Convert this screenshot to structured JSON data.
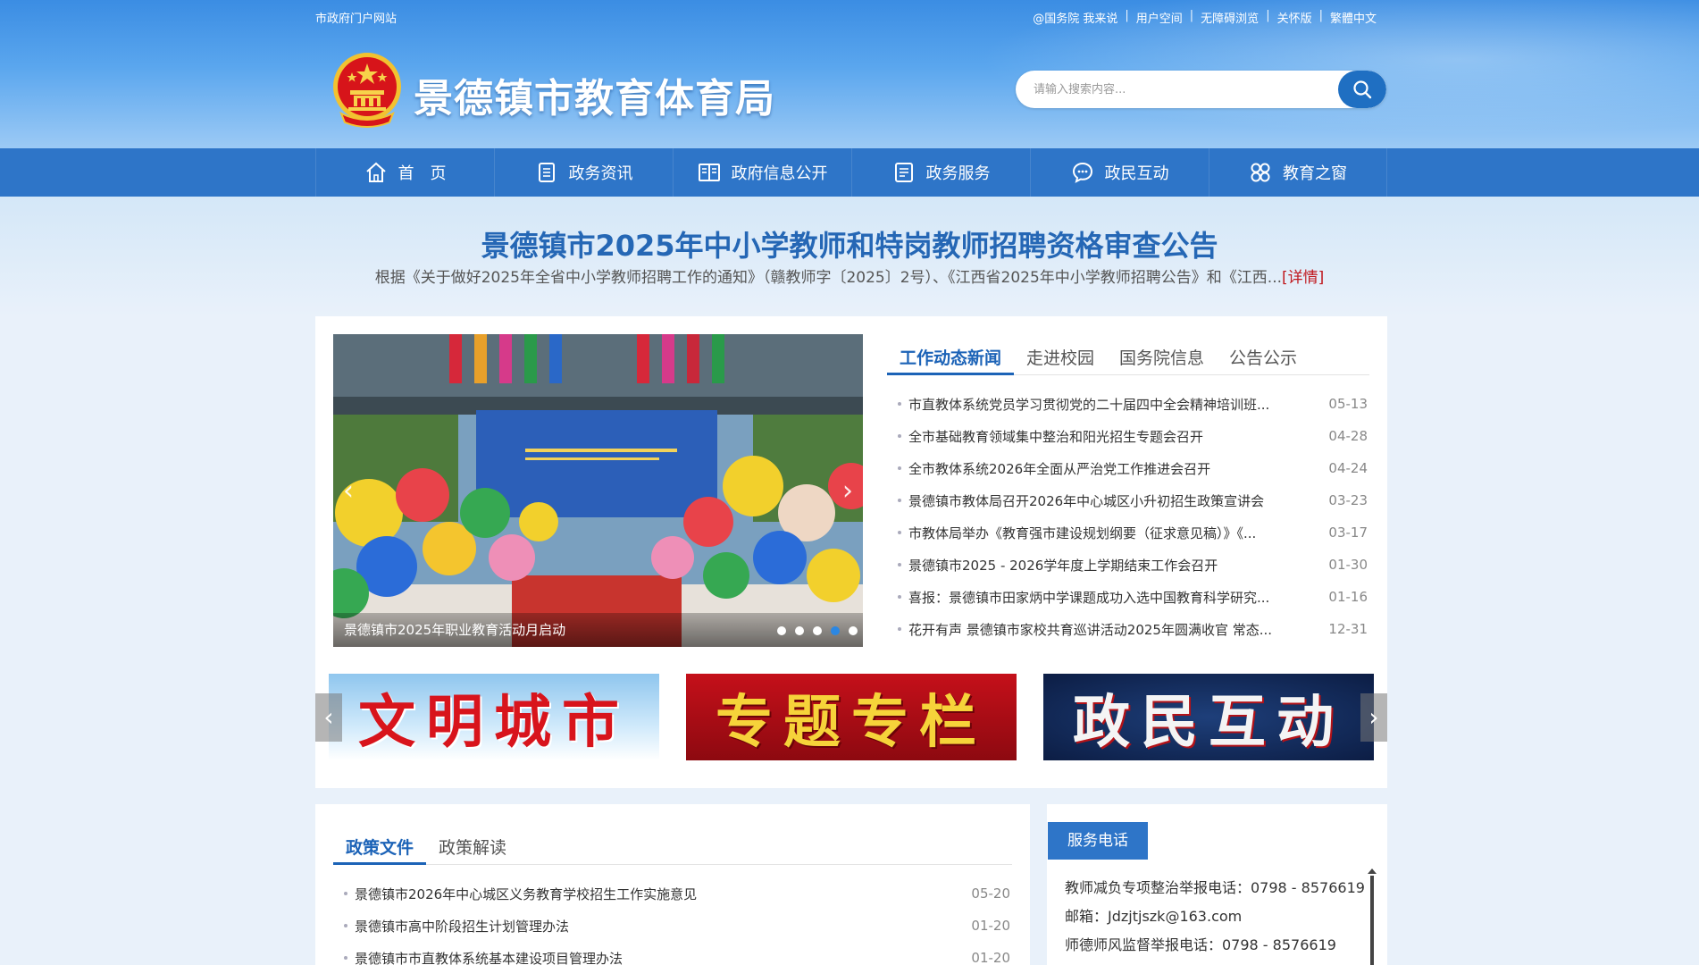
{
  "topbar": {
    "portal_link": "市政府门户网站",
    "links": [
      "@国务院 我来说",
      "用户空间",
      "无障碍浏览",
      "关怀版",
      "繁體中文"
    ]
  },
  "site": {
    "title": "景德镇市教育体育局"
  },
  "search": {
    "placeholder": "请输入搜索内容..."
  },
  "nav": {
    "items": [
      {
        "label": "首　页",
        "icon": "home-icon"
      },
      {
        "label": "政务资讯",
        "icon": "document-icon"
      },
      {
        "label": "政府信息公开",
        "icon": "book-open-icon"
      },
      {
        "label": "政务服务",
        "icon": "list-document-icon"
      },
      {
        "label": "政民互动",
        "icon": "chat-icon"
      },
      {
        "label": "教育之窗",
        "icon": "grid-circles-icon"
      }
    ]
  },
  "announcement": {
    "title": "景德镇市2025年中小学教师和特岗教师招聘资格审查公告",
    "body": "根据《关于做好2025年全省中小学教师招聘工作的通知》（赣教师字〔2025〕2号）、《江西省2025年中小学教师招聘公告》和《江西...",
    "more": "[详情]"
  },
  "carousel": {
    "caption": "景德镇市2025年职业教育活动月启动",
    "dot_count": 5,
    "active_dot": 4,
    "prev": "‹",
    "next": "›"
  },
  "news": {
    "tabs": [
      "工作动态新闻",
      "走进校园",
      "国务院信息",
      "公告公示"
    ],
    "active_tab": 0,
    "items": [
      {
        "title": "市直教体系统党员学习贯彻党的二十届四中全会精神培训班...",
        "date": "05-13"
      },
      {
        "title": "全市基础教育领域集中整治和阳光招生专题会召开",
        "date": "04-28"
      },
      {
        "title": "全市教体系统2026年全面从严治党工作推进会召开",
        "date": "04-24"
      },
      {
        "title": "景德镇市教体局召开2026年中心城区小升初招生政策宣讲会",
        "date": "03-23"
      },
      {
        "title": "市教体局举办《教育强市建设规划纲要（征求意见稿）》《...",
        "date": "03-17"
      },
      {
        "title": "景德镇市2025 - 2026学年度上学期结束工作会召开",
        "date": "01-30"
      },
      {
        "title": "喜报：景德镇市田家炳中学课题成功入选中国教育科学研究...",
        "date": "01-16"
      },
      {
        "title": "花开有声 景德镇市家校共育巡讲活动2025年圆满收官 常态...",
        "date": "12-31"
      }
    ]
  },
  "banners": {
    "items": [
      {
        "label": "文明城市"
      },
      {
        "label": "专题专栏"
      },
      {
        "label": "政民互动"
      }
    ],
    "prev": "‹",
    "next": "›"
  },
  "policy": {
    "tabs": [
      "政策文件",
      "政策解读"
    ],
    "active_tab": 0,
    "items": [
      {
        "title": "景德镇市2026年中心城区义务教育学校招生工作实施意见",
        "date": "05-20"
      },
      {
        "title": "景德镇市高中阶段招生计划管理办法",
        "date": "01-20"
      },
      {
        "title": "景德镇市市直教体系统基本建设项目管理办法",
        "date": "01-20"
      }
    ]
  },
  "service": {
    "title": "服务电话",
    "lines": [
      "教师减负专项整治举报电话：0798 - 8576619",
      "邮箱：Jdzjtjszk@163.com",
      "师德师风监督举报电话：0798 - 8576619"
    ]
  },
  "colors": {
    "primary": "#2e75c8",
    "title_blue": "#2567b5",
    "accent_red": "#c0181e",
    "active_dot": "#2b87e3"
  }
}
